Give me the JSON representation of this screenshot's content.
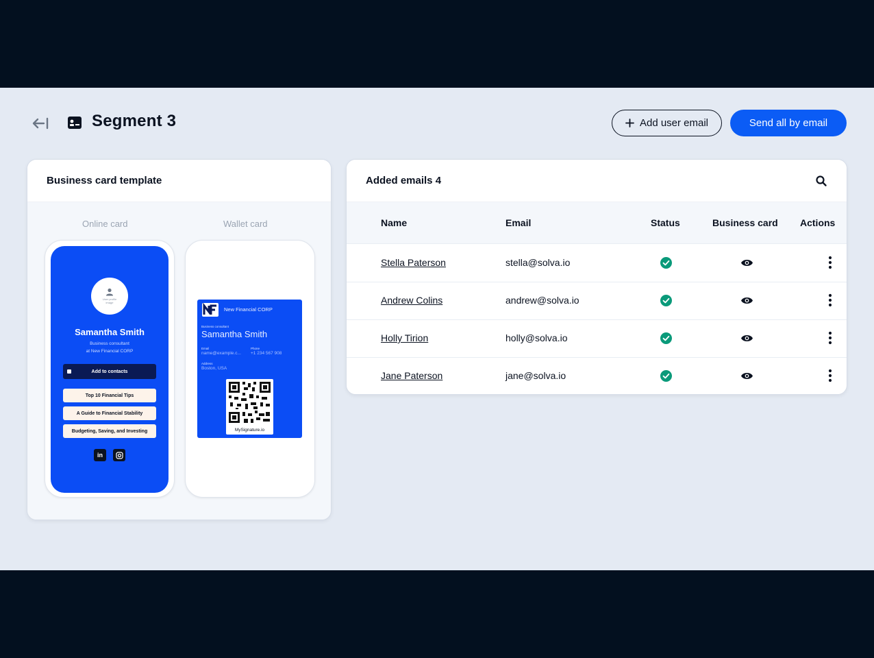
{
  "header": {
    "title": "Segment 3",
    "add_user_email_label": "Add user email",
    "send_all_label": "Send all by email"
  },
  "template_panel": {
    "title": "Business card template",
    "online_card_label": "Online card",
    "wallet_card_label": "Wallet card",
    "online_card": {
      "avatar_placeholder": "User profile image",
      "name": "Samantha Smith",
      "role": "Business consultant",
      "company": "at New Financial CORP",
      "add_to_contacts": "Add to contacts",
      "links": [
        "Top 10 Financial Tips",
        "A Guide to Financial Stability",
        "Budgeting, Saving, and Investing"
      ],
      "socials": [
        "linkedin-icon",
        "instagram-icon"
      ]
    },
    "wallet_card": {
      "company": "New Financial CORP",
      "role_label": "Business consultant",
      "name": "Samantha Smith",
      "email_label": "Email",
      "email_value": "name@example.c...",
      "phone_label": "Phone",
      "phone_value": "+1 234 567 908",
      "address_label": "Address",
      "address_value": "Boston, USA",
      "qr_label": "MySignature.io"
    }
  },
  "emails_panel": {
    "title": "Added emails 4",
    "columns": [
      "Name",
      "Email",
      "Status",
      "Business card",
      "Actions"
    ],
    "rows": [
      {
        "name": "Stella Paterson",
        "email": "stella@solva.io",
        "status": "sent"
      },
      {
        "name": "Andrew Colins",
        "email": "andrew@solva.io",
        "status": "sent"
      },
      {
        "name": "Holly Tirion",
        "email": "holly@solva.io",
        "status": "sent"
      },
      {
        "name": "Jane Paterson",
        "email": "jane@solva.io",
        "status": "sent"
      }
    ]
  },
  "colors": {
    "accent": "#0b5cf5",
    "card_blue": "#0b4df5",
    "status_ok": "#0a9a7a",
    "background": "#e4eaf3",
    "frame": "#03101f"
  }
}
